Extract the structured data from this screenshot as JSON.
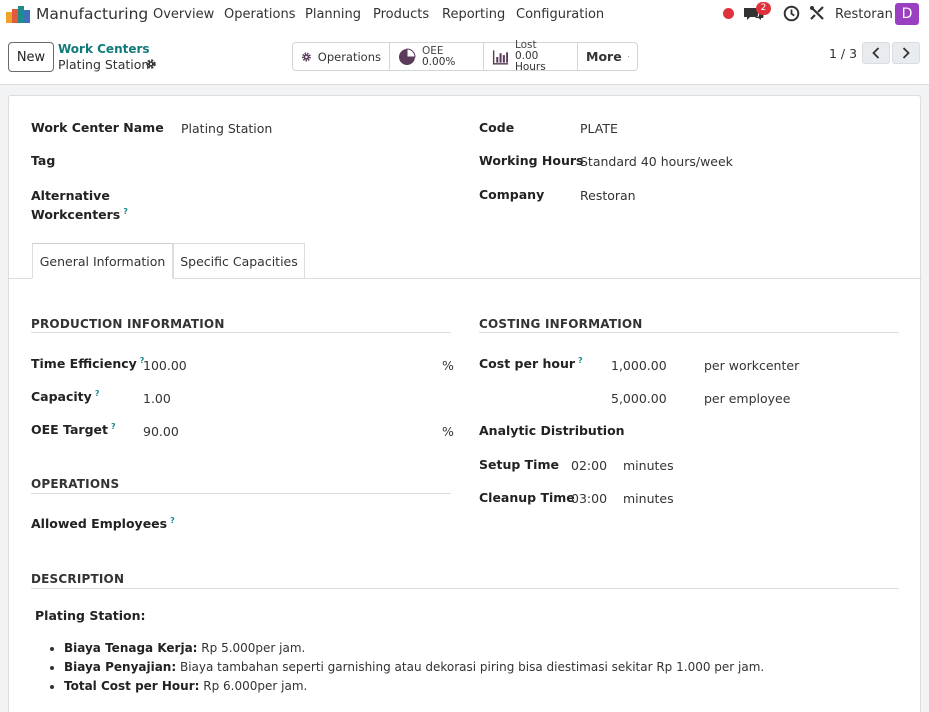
{
  "navbar": {
    "app_title": "Manufacturing",
    "menu": [
      "Overview",
      "Operations",
      "Planning",
      "Products",
      "Reporting",
      "Configuration"
    ],
    "chat_count": "2",
    "company": "Restoran",
    "avatar_letter": "D"
  },
  "control": {
    "new_label": "New",
    "breadcrumb": "Work Centers",
    "record_name": "Plating Station",
    "smart": {
      "operations_label": "Operations",
      "oee_label": "OEE",
      "oee_value": "0.00%",
      "lost_label": "Lost",
      "lost_value": "0.00 Hours",
      "more_label": "More"
    },
    "pager": "1 / 3"
  },
  "form": {
    "work_center_name_label": "Work Center Name",
    "work_center_name": "Plating Station",
    "tag_label": "Tag",
    "alt_label_1": "Alternative",
    "alt_label_2": "Workcenters",
    "code_label": "Code",
    "code": "PLATE",
    "working_hours_label": "Working Hours",
    "working_hours": "Standard 40 hours/week",
    "company_label": "Company",
    "company": "Restoran",
    "help_mark": "?"
  },
  "tabs": [
    "General Information",
    "Specific Capacities"
  ],
  "production": {
    "title": "PRODUCTION INFORMATION",
    "time_efficiency_label": "Time Efficiency",
    "time_efficiency": "100.00",
    "capacity_label": "Capacity",
    "capacity": "1.00",
    "oee_target_label": "OEE Target",
    "oee_target": "90.00",
    "percent": "%"
  },
  "operations": {
    "title": "OPERATIONS",
    "allowed_employees_label": "Allowed Employees"
  },
  "costing": {
    "title": "COSTING INFORMATION",
    "cost_per_hour_label": "Cost per hour",
    "cost_workcenter": "1,000.00",
    "per_workcenter": "per workcenter",
    "cost_employee": "5,000.00",
    "per_employee": "per employee",
    "analytic_label": "Analytic Distribution",
    "setup_label": "Setup Time",
    "setup_value": "02:00",
    "cleanup_label": "Cleanup Time",
    "cleanup_value": "03:00",
    "minutes": "minutes"
  },
  "description": {
    "title": "DESCRIPTION",
    "heading": "Plating Station:",
    "items": [
      {
        "label": "Biaya Tenaga Kerja:",
        "text": " Rp 5.000per jam."
      },
      {
        "label": "Biaya Penyajian:",
        "text": " Biaya tambahan seperti garnishing atau dekorasi piring bisa diestimasi sekitar Rp 1.000 per jam."
      },
      {
        "label": "Total Cost per Hour:",
        "text": " Rp 6.000per jam."
      }
    ]
  },
  "colors": {
    "brand_teal": "#0f7a7a",
    "avatar": "#9b3fc2",
    "alert_red": "#e0323c"
  }
}
